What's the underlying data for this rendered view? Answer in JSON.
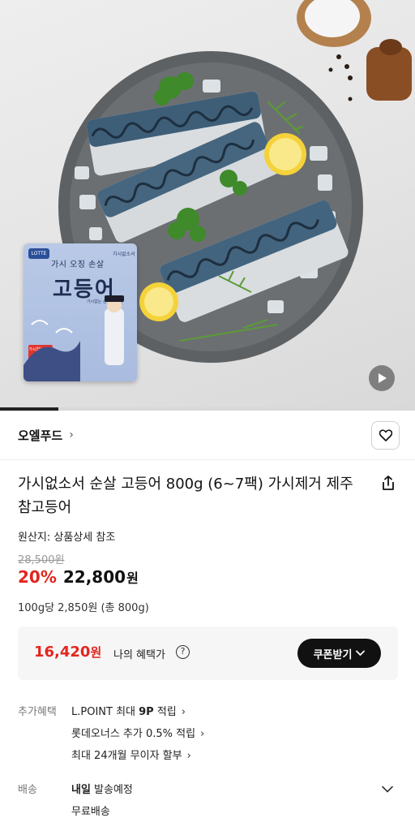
{
  "video": {
    "progress": 0.14
  },
  "package": {
    "badge": "LOTTE",
    "brand": "가시없소서",
    "subtitle": "가시 오징 손살",
    "title": "고등어",
    "caption": "가시없는 순살 고등어",
    "label": "가시없는 순살"
  },
  "brand": {
    "name": "오엘푸드",
    "chevron": "›"
  },
  "product": {
    "title": "가시없소서 순살 고등어 800g (6~7팩) 가시제거 제주 참고등어",
    "origin": "원산지: 상품상세 참조",
    "original_price": "28,500원",
    "discount": "20%",
    "sale_price": "22,800",
    "sale_currency": "원",
    "unit_price": "100g당 2,850원 (총 800g)"
  },
  "coupon": {
    "benefit_price": "16,420",
    "benefit_currency": "원",
    "benefit_label": "나의 혜택가",
    "help": "?",
    "button_label": "쿠폰받기",
    "button_chevron": "⌄"
  },
  "benefits": {
    "label": "추가혜택",
    "lpoint_prefix": "L.POINT 최대 ",
    "lpoint_value": "9P",
    "lpoint_suffix": " 적립",
    "giftcard": "롯데오너스 추가 0.5% 적립",
    "installment": "최대 24개월 무이자 할부",
    "chevron": "›"
  },
  "shipping": {
    "label": "배송",
    "day": "내일",
    "status": " 발송예정",
    "fee": "무료배송"
  },
  "icons": {
    "heart": "heart-icon",
    "share": "share-icon",
    "play": "play-icon",
    "help": "help-icon",
    "chevron": "chevron-down-icon"
  },
  "colors": {
    "accent_red": "#e2261f",
    "dark": "#111111",
    "coupon_bg": "#f6f6f6"
  }
}
